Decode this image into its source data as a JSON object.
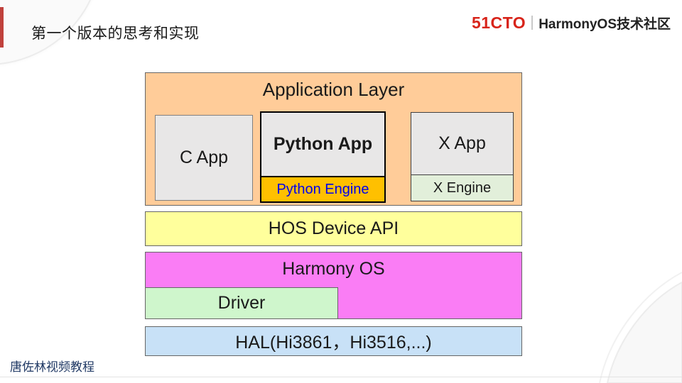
{
  "slide": {
    "title": "第一个版本的思考和实现",
    "footer": "唐佐林视频教程"
  },
  "logo": {
    "brand": "51CTO",
    "community": "HarmonyOS技术社区"
  },
  "diagram": {
    "application_layer": {
      "label": "Application Layer",
      "fill": "#FFCC99"
    },
    "c_app": {
      "label": "C App",
      "fill": "#E8E7E7"
    },
    "python_app": {
      "label": "Python App",
      "fill": "#E8E7E7"
    },
    "python_engine": {
      "label": "Python Engine",
      "fill": "#FFC000",
      "text_color": "#0000EE"
    },
    "x_app": {
      "label": "X App",
      "fill": "#E8E7E7"
    },
    "x_engine": {
      "label": "X Engine",
      "fill": "#E2EFDA"
    },
    "hos_device_api": {
      "label": "HOS Device API",
      "fill": "#FFFF9C"
    },
    "harmony_os": {
      "label": "Harmony OS",
      "fill": "#FA7DF5"
    },
    "driver": {
      "label": "Driver",
      "fill": "#CFF6CC"
    },
    "hal": {
      "label": "HAL(Hi3861，Hi3516,...)",
      "fill": "#C8E1F7"
    }
  },
  "colors": {
    "accent_bar": "#C0413C",
    "brand_red": "#D8241A",
    "footer_text": "#1F3864"
  }
}
